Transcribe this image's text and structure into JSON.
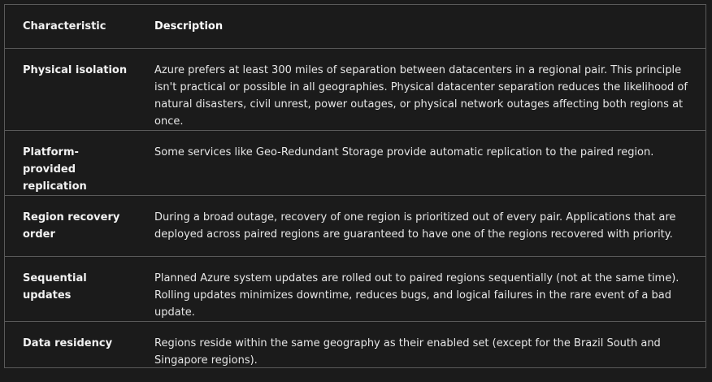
{
  "table": {
    "headers": [
      "Characteristic",
      "Description"
    ],
    "rows": [
      {
        "characteristic": "Physical isolation",
        "description": "Azure prefers at least 300 miles of separation between datacenters in a regional pair. This principle isn't practical or possible in all geographies. Physical datacenter separation reduces the likelihood of natural disasters, civil unrest, power outages, or physical network outages affecting both regions at once."
      },
      {
        "characteristic": "Platform-provided replication",
        "description": "Some services like Geo-Redundant Storage provide automatic replication to the paired region."
      },
      {
        "characteristic": "Region recovery order",
        "description": "During a broad outage, recovery of one region is prioritized out of every pair. Applications that are deployed across paired regions are guaranteed to have one of the regions recovered with priority."
      },
      {
        "characteristic": "Sequential updates",
        "description": "Planned Azure system updates are rolled out to paired regions sequentially (not at the same time). Rolling updates minimizes downtime, reduces bugs, and logical failures in the rare event of a bad update."
      },
      {
        "characteristic": "Data residency",
        "description": "Regions reside within the same geography as their enabled set (except for the Brazil South and Singapore regions)."
      }
    ]
  }
}
